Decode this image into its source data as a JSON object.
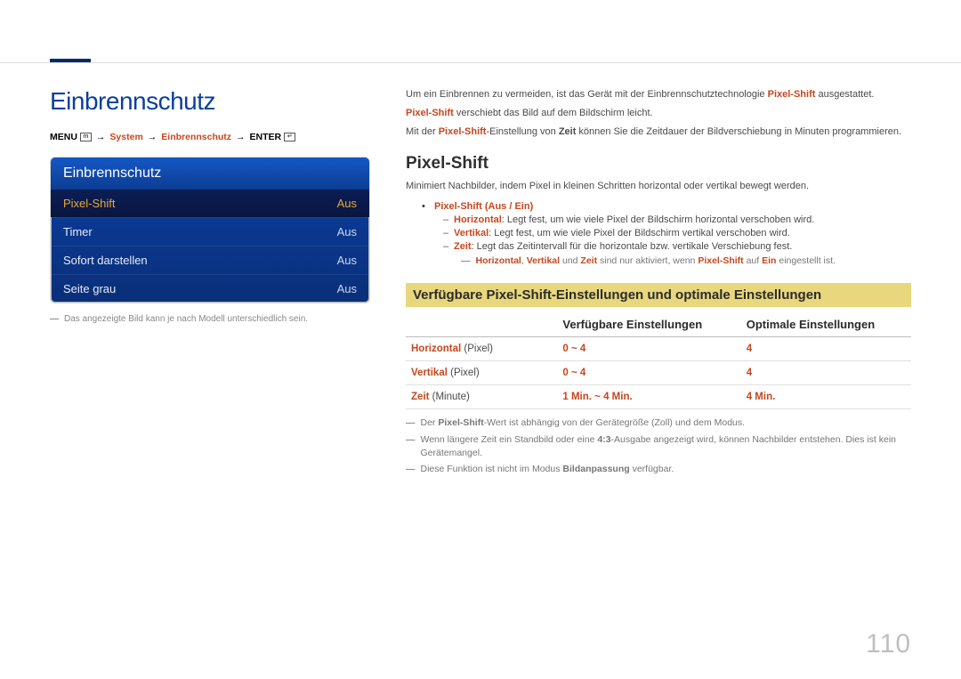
{
  "page_number": "110",
  "left": {
    "heading": "Einbrennschutz",
    "breadcrumb": {
      "menu": "MENU",
      "menu_icon": "m",
      "system": "System",
      "einbrennschutz": "Einbrennschutz",
      "enter": "ENTER",
      "enter_icon": "↵"
    },
    "osd": {
      "title": "Einbrennschutz",
      "rows": [
        {
          "label": "Pixel-Shift",
          "value": "Aus",
          "selected": true
        },
        {
          "label": "Timer",
          "value": "Aus",
          "selected": false
        },
        {
          "label": "Sofort darstellen",
          "value": "Aus",
          "selected": false
        },
        {
          "label": "Seite grau",
          "value": "Aus",
          "selected": false
        }
      ]
    },
    "footnote": "Das angezeigte Bild kann je nach Modell unterschiedlich sein."
  },
  "right": {
    "intro": {
      "line1_pre": "Um ein Einbrennen zu vermeiden, ist das Gerät mit der Einbrennschutztechnologie ",
      "line1_accent": "Pixel-Shift",
      "line1_post": " ausgestattet.",
      "line2_accent": "Pixel-Shift",
      "line2_post": " verschiebt das Bild auf dem Bildschirm leicht.",
      "line3_pre": "Mit der ",
      "line3_accent": "Pixel-Shift",
      "line3_mid": "-Einstellung von ",
      "line3_bold": "Zeit",
      "line3_post": " können Sie die Zeitdauer der Bildverschiebung in Minuten programmieren."
    },
    "pixel_shift": {
      "heading": "Pixel-Shift",
      "desc": "Minimiert Nachbilder, indem Pixel in kleinen Schritten horizontal oder vertikal bewegt werden.",
      "bullet_label": "Pixel-Shift",
      "bullet_opts": " (Aus / Ein)",
      "sub": [
        {
          "label": "Horizontal",
          "desc": ": Legt fest, um wie viele Pixel der Bildschirm horizontal verschoben wird."
        },
        {
          "label": "Vertikal",
          "desc": ": Legt fest, um wie viele Pixel der Bildschirm vertikal verschoben wird."
        },
        {
          "label": "Zeit",
          "desc": ": Legt das Zeitintervall für die horizontale bzw. vertikale Verschiebung fest."
        }
      ],
      "note_a": "Horizontal",
      "note_b": "Vertikal",
      "note_c": "Zeit",
      "note_mid1": ", ",
      "note_mid2": " und ",
      "note_mid3": " sind nur aktiviert, wenn ",
      "note_d": "Pixel-Shift",
      "note_mid4": " auf ",
      "note_e": "Ein",
      "note_end": " eingestellt ist."
    },
    "table_heading": "Verfügbare Pixel-Shift-Einstellungen und optimale Einstellungen",
    "table": {
      "col1": "",
      "col2": "Verfügbare Einstellungen",
      "col3": "Optimale Einstellungen",
      "rows": [
        {
          "label_accent": "Horizontal",
          "label_plain": " (Pixel)",
          "available": "0 ~ 4",
          "optimal": "4"
        },
        {
          "label_accent": "Vertikal",
          "label_plain": " (Pixel)",
          "available": "0 ~ 4",
          "optimal": "4"
        },
        {
          "label_accent": "Zeit",
          "label_plain": " (Minute)",
          "available": "1 Min. ~ 4 Min.",
          "optimal": "4 Min."
        }
      ]
    },
    "table_notes": [
      {
        "pre": "Der ",
        "b1": "Pixel-Shift",
        "post": "-Wert ist abhängig von der Gerätegröße (Zoll) und dem Modus."
      },
      {
        "pre": "Wenn längere Zeit ein Standbild oder eine ",
        "b1": "4:3",
        "post": "-Ausgabe angezeigt wird, können Nachbilder entstehen. Dies ist kein Gerätemangel."
      },
      {
        "pre": "Diese Funktion ist nicht im Modus ",
        "b1": "Bildanpassung",
        "post": " verfügbar."
      }
    ]
  }
}
